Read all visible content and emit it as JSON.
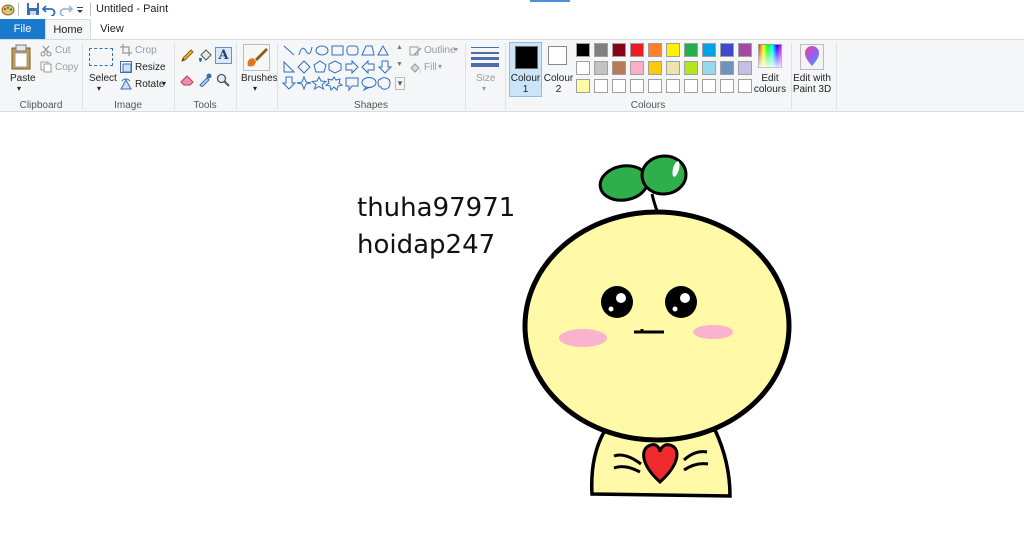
{
  "window": {
    "title": "Untitled - Paint"
  },
  "tabs": {
    "file": "File",
    "home": "Home",
    "view": "View"
  },
  "clipboard": {
    "paste": "Paste",
    "cut": "Cut",
    "copy": "Copy",
    "group": "Clipboard"
  },
  "image": {
    "select": "Select",
    "crop": "Crop",
    "resize": "Resize",
    "rotate": "Rotate",
    "group": "Image"
  },
  "tools": {
    "group": "Tools",
    "items": [
      "pencil-icon",
      "fill-icon",
      "text-icon",
      "eraser-icon",
      "color-picker-icon",
      "magnifier-icon"
    ]
  },
  "brushes": {
    "label": "Brushes"
  },
  "shapes": {
    "group": "Shapes",
    "outline": "Outline",
    "fill": "Fill"
  },
  "size": {
    "label": "Size"
  },
  "colours": {
    "group": "Colours",
    "colour1_label": "Colour\n1",
    "colour1_line1": "Colour",
    "colour1_line2": "1",
    "colour2_line1": "Colour",
    "colour2_line2": "2",
    "colour1": "#000000",
    "colour2": "#ffffff",
    "palette_row1": [
      "#000000",
      "#7f7f7f",
      "#880015",
      "#ed1c24",
      "#ff7f27",
      "#fff200",
      "#22b14c",
      "#00a2e8",
      "#3f48cc",
      "#a349a4"
    ],
    "palette_row2": [
      "#ffffff",
      "#c3c3c3",
      "#b97a57",
      "#ffaec9",
      "#ffc90e",
      "#efe4b0",
      "#b5e61d",
      "#99d9ea",
      "#7092be",
      "#c8bfe7"
    ],
    "palette_row3": [
      "#fff9a8",
      "#ffffff",
      "#ffffff",
      "#ffffff",
      "#ffffff",
      "#ffffff",
      "#ffffff",
      "#ffffff",
      "#ffffff",
      "#ffffff"
    ],
    "edit_line1": "Edit",
    "edit_line2": "colours"
  },
  "paint3d": {
    "line1": "Edit with",
    "line2": "Paint 3D"
  },
  "canvas": {
    "text_line1": "thuha97971",
    "text_line2": "hoidap247"
  }
}
